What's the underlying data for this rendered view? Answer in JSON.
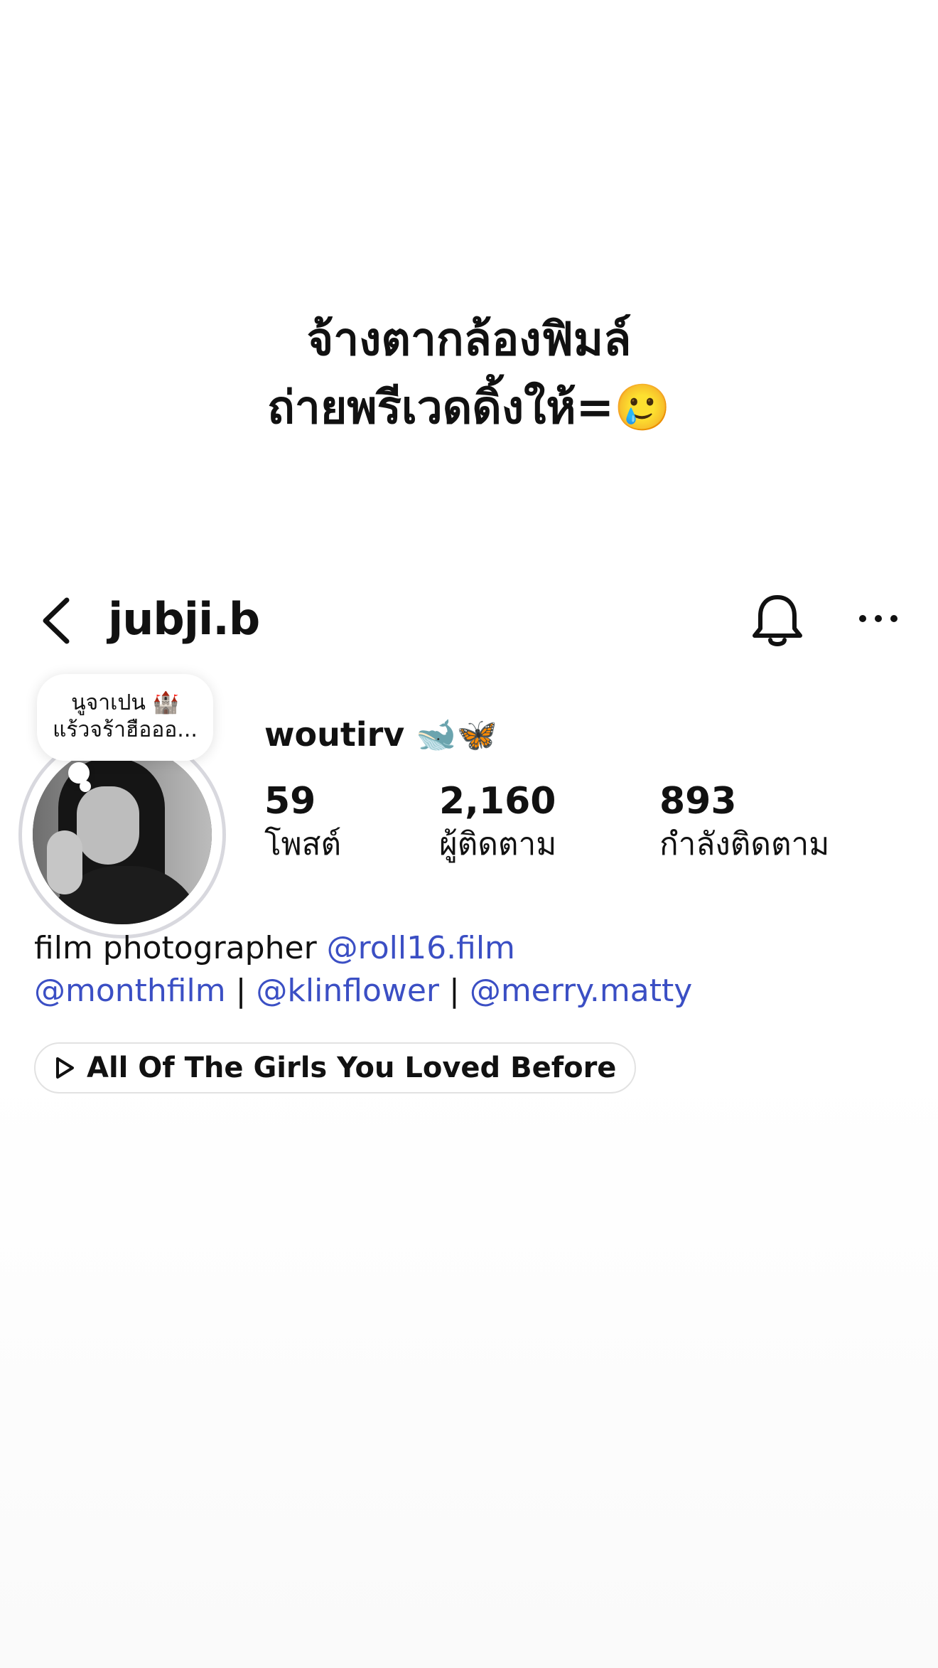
{
  "caption": {
    "line1": "จ้างตากล้องฟิมล์",
    "line2": "ถ่ายพรีเวดดิ้งให้=🥲"
  },
  "header": {
    "username": "jubji.b"
  },
  "note": {
    "line1": "นูจาเปน 🏰",
    "line2": "แร้วจร้าฮือออ..."
  },
  "profile": {
    "display_name": "woutirv 🐋🦋"
  },
  "stats": {
    "posts": {
      "value": "59",
      "label": "โพสต์"
    },
    "followers": {
      "value": "2,160",
      "label": "ผู้ติดตาม"
    },
    "following": {
      "value": "893",
      "label": "กำลังติดตาม"
    }
  },
  "bio": {
    "text_prefix": "film photographer ",
    "mention_roll16": "@roll16.film",
    "mention_monthfilm": "@monthfilm",
    "separator_1": " | ",
    "mention_klinflower": "@klinflower",
    "separator_2": " | ",
    "mention_merry": "@merry.matty"
  },
  "music": {
    "title": "All Of The Girls You Loved Before"
  },
  "colors": {
    "mention": "#3b4fc4",
    "ring": "#d8d8de"
  },
  "icons": {
    "back": "chevron-left-icon",
    "bell": "bell-icon",
    "more": "more-horizontal-icon",
    "play": "play-icon"
  }
}
